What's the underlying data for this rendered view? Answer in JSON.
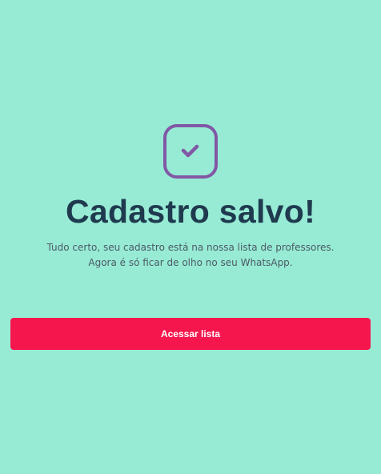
{
  "success": {
    "icon": "check-square-icon",
    "title": "Cadastro salvo!",
    "description_line1": "Tudo certo, seu cadastro está na nossa lista de professores.",
    "description_line2": "Agora é só ficar de olho no seu WhatsApp.",
    "button_label": "Acessar lista"
  },
  "colors": {
    "background": "#97ebd4",
    "title": "#1f3a4f",
    "text": "#4c5a66",
    "icon": "#8257a6",
    "button": "#f5164d",
    "button_text": "#ffffff"
  }
}
